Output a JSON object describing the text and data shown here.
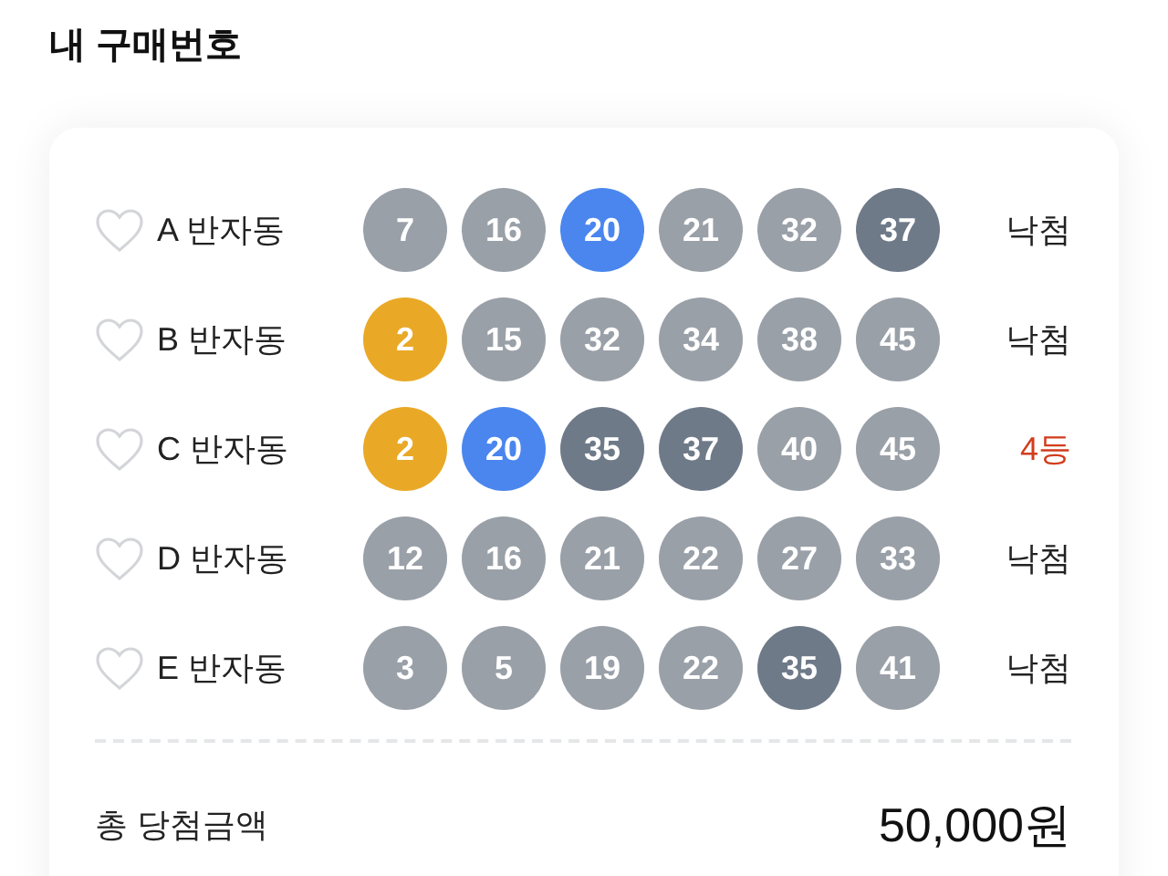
{
  "title": "내 구매번호",
  "games": [
    {
      "label": "A 반자동",
      "liked": false,
      "result": "낙첨",
      "win": false,
      "numbers": [
        {
          "n": "7",
          "color": "#9aa0a8"
        },
        {
          "n": "16",
          "color": "#9aa0a8"
        },
        {
          "n": "20",
          "color": "#4a86ee"
        },
        {
          "n": "21",
          "color": "#9aa0a8"
        },
        {
          "n": "32",
          "color": "#9aa0a8"
        },
        {
          "n": "37",
          "color": "#6f7a89"
        }
      ]
    },
    {
      "label": "B 반자동",
      "liked": false,
      "result": "낙첨",
      "win": false,
      "numbers": [
        {
          "n": "2",
          "color": "#e9a927"
        },
        {
          "n": "15",
          "color": "#9aa0a8"
        },
        {
          "n": "32",
          "color": "#9aa0a8"
        },
        {
          "n": "34",
          "color": "#9aa0a8"
        },
        {
          "n": "38",
          "color": "#9aa0a8"
        },
        {
          "n": "45",
          "color": "#9aa0a8"
        }
      ]
    },
    {
      "label": "C 반자동",
      "liked": false,
      "result": "4등",
      "win": true,
      "numbers": [
        {
          "n": "2",
          "color": "#e9a927"
        },
        {
          "n": "20",
          "color": "#4a86ee"
        },
        {
          "n": "35",
          "color": "#6f7a89"
        },
        {
          "n": "37",
          "color": "#6f7a89"
        },
        {
          "n": "40",
          "color": "#9aa0a8"
        },
        {
          "n": "45",
          "color": "#9aa0a8"
        }
      ]
    },
    {
      "label": "D 반자동",
      "liked": false,
      "result": "낙첨",
      "win": false,
      "numbers": [
        {
          "n": "12",
          "color": "#9aa0a8"
        },
        {
          "n": "16",
          "color": "#9aa0a8"
        },
        {
          "n": "21",
          "color": "#9aa0a8"
        },
        {
          "n": "22",
          "color": "#9aa0a8"
        },
        {
          "n": "27",
          "color": "#9aa0a8"
        },
        {
          "n": "33",
          "color": "#9aa0a8"
        }
      ]
    },
    {
      "label": "E 반자동",
      "liked": false,
      "result": "낙첨",
      "win": false,
      "numbers": [
        {
          "n": "3",
          "color": "#9aa0a8"
        },
        {
          "n": "5",
          "color": "#9aa0a8"
        },
        {
          "n": "19",
          "color": "#9aa0a8"
        },
        {
          "n": "22",
          "color": "#9aa0a8"
        },
        {
          "n": "35",
          "color": "#6f7a89"
        },
        {
          "n": "41",
          "color": "#9aa0a8"
        }
      ]
    }
  ],
  "total": {
    "label": "총 당첨금액",
    "amount": "50,000원"
  }
}
